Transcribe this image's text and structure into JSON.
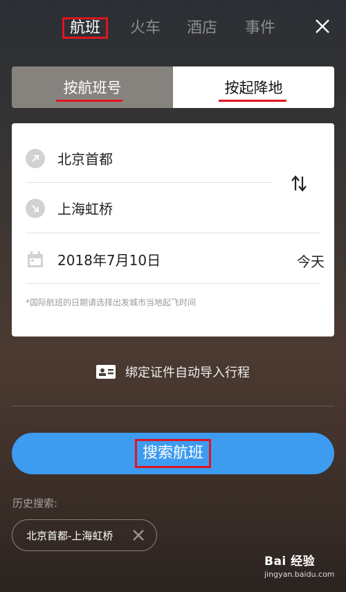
{
  "top_tabs": [
    {
      "label": "航班"
    },
    {
      "label": "火车"
    },
    {
      "label": "酒店"
    },
    {
      "label": "事件"
    }
  ],
  "segment": {
    "by_flight_no": "按航班号",
    "by_route": "按起降地"
  },
  "form": {
    "departure_city": "北京首都",
    "arrival_city": "上海虹桥",
    "date": "2018年7月10日",
    "date_relative": "今天",
    "note": "*国际航班的日期请选择出发城市当地起飞时间"
  },
  "bind_id_text": "绑定证件自动导入行程",
  "search_button": "搜索航班",
  "history": {
    "title": "历史搜索:",
    "items": [
      {
        "label": "北京首都-上海虹桥"
      }
    ]
  },
  "watermark": {
    "brand": "Bai 经验",
    "url": "jingyan.baidu.com"
  },
  "colors": {
    "accent_blue": "#3d9bf0",
    "highlight_red": "#e0141e"
  }
}
